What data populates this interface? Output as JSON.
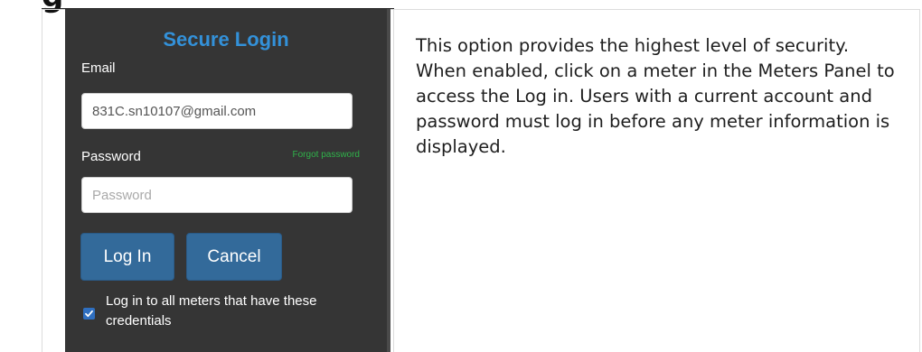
{
  "doc": {
    "heading_fragment": "g"
  },
  "login": {
    "title": "Secure Login",
    "email_label": "Email",
    "email_value": "831C.sn10107@gmail.com",
    "password_label": "Password",
    "forgot_password": "Forgot password",
    "password_placeholder": "Password",
    "login_button": "Log In",
    "cancel_button": "Cancel",
    "remember_checked": true,
    "remember_label": "Log in to all meters that have these credentials"
  },
  "description": "This option provides the highest level of security. When enabled, click on a meter in the Meters Panel to access the Log in. Users with a current account and password must log in before any meter information is displayed.",
  "colors": {
    "panel_background": "#353535",
    "title": "#3391d9",
    "button": "#336a9a",
    "forgot_link": "#2fb24a",
    "checkbox": "#2f6fc0"
  }
}
